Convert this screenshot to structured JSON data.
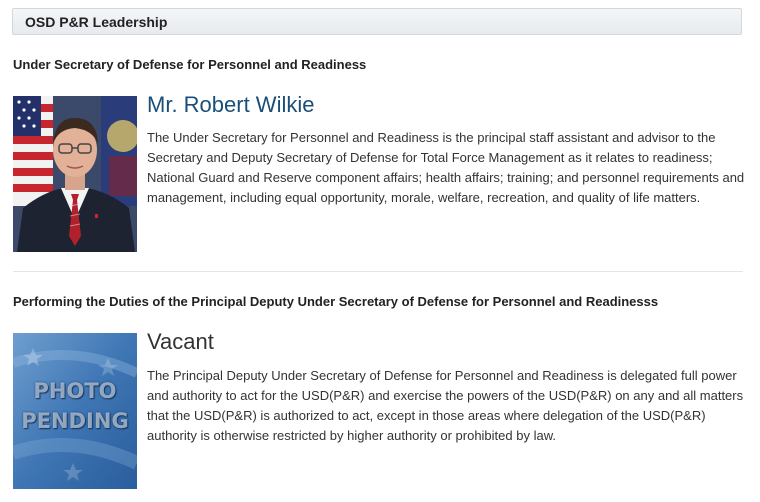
{
  "header": {
    "title": "OSD P&R Leadership"
  },
  "leaders": [
    {
      "role": "Under Secretary of Defense for Personnel and Readiness",
      "name": "Mr. Robert Wilkie",
      "name_color": "#1a4f7a",
      "bio": "The Under Secretary for Personnel and Readiness is the principal staff assistant and advisor to the Secretary and Deputy Secretary of Defense for Total Force Management as it relates to readiness; National Guard and Reserve component affairs; health affairs; training; and personnel requirements and management, including equal opportunity, morale, welfare, recreation, and quality of life matters."
    },
    {
      "role": "Performing the Duties of the Principal Deputy Under Secretary of Defense for Personnel and Readinesss",
      "name": "Vacant",
      "name_color": "#333333",
      "photo_placeholder_line1": "PHOTO",
      "photo_placeholder_line2": "PENDING",
      "bio": "The Principal Deputy Under Secretary of Defense for Personnel and Readiness is delegated full power and authority to act for the USD(P&R) and exercise the powers of the USD(P&R) on any and all matters that the USD(P&R) is authorized to act, except in those areas where delegation of the USD(P&R) authority is otherwise restricted by higher authority or prohibited by law."
    }
  ]
}
